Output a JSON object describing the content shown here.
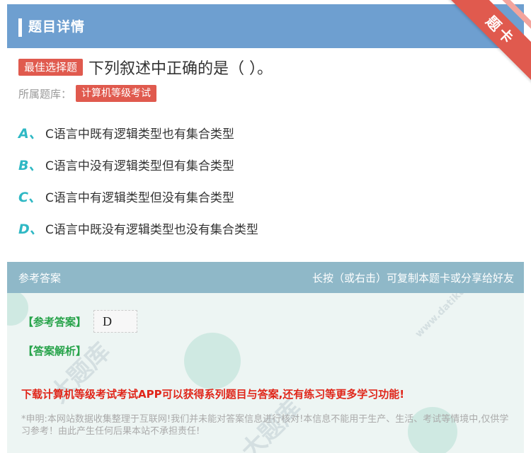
{
  "header": {
    "title": "题目详情",
    "corner_badge": "题卡"
  },
  "question": {
    "type_tag": "最佳选择题",
    "text": "下列叙述中正确的是（   ）。",
    "source_label": "所属题库：",
    "source_tag": "计算机等级考试",
    "options": [
      {
        "letter": "A、",
        "text": "C语言中既有逻辑类型也有集合类型"
      },
      {
        "letter": "B、",
        "text": "C语言中没有逻辑类型但有集合类型"
      },
      {
        "letter": "C、",
        "text": "C语言中有逻辑类型但没有集合类型"
      },
      {
        "letter": "D、",
        "text": "C语言中既没有逻辑类型也没有集合类型"
      }
    ]
  },
  "answer": {
    "header_left": "参考答案",
    "header_right": "长按（或右击）可复制本题卡或分享给好友",
    "answer_label": "【参考答案】",
    "answer_value": "D",
    "analysis_label": "【答案解析】",
    "promo": "下载计算机等级考试考试APP可以获得系列题目与答案,还有练习等更多学习功能!",
    "notice": "*申明:本网站数据收集整理于互联网!我们并未能对答案信息进行核对!本信息不能用于生产、生活、考试等情境中,仅供学习参考！由此产生任何后果本站不承担责任!"
  },
  "watermark": {
    "text_cn": "大题库",
    "text_en": "www.datiku.com"
  },
  "colors": {
    "header_bg": "#6e9fd0",
    "tag_red": "#e05a4e",
    "option_letter": "#2fb8c4",
    "answer_header_bg": "#8fb8c8",
    "answer_label": "#27a34a",
    "promo": "#e0261a"
  }
}
